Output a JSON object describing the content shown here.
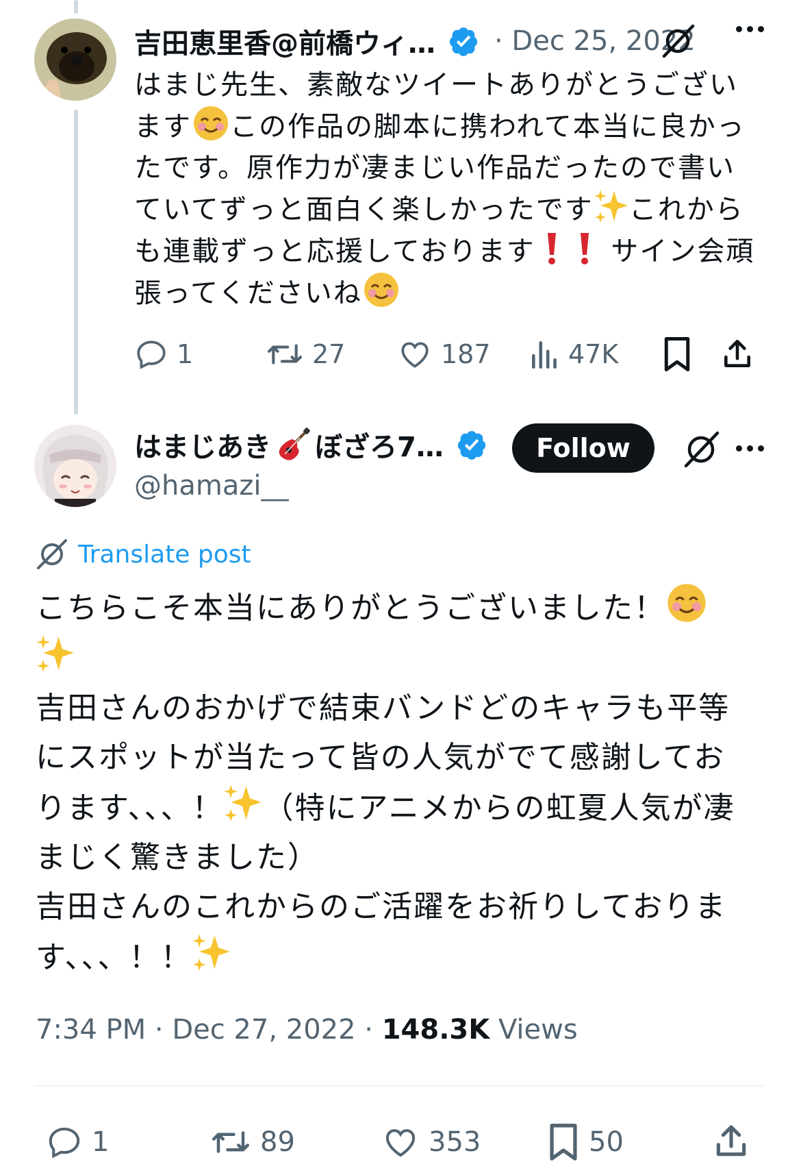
{
  "reply_tweet": {
    "author_name": "吉田恵里香@前橋ウィ…",
    "date": "· Dec 25, 2022",
    "text": "はまじ先生、素敵なツイートありがとうございます😊この作品の脚本に携われて本当に良かったです。原作力が凄まじい作品だったので書いていてずっと面白く楽しかったです✨これからも連載ずっと応援しております❗️❗️サイン会頑張ってくださいね😊",
    "text_parts": {
      "p1": "はまじ先生、素敵なツイートありがとうござい\nます",
      "p2": "この作品の脚本に携われて本当に良かっ\nたです。原作力が凄まじい作品だったので書い\nていてずっと面白く楽しかったです",
      "p3": "これから\nも連載ずっと応援しております",
      "p4": " サイン会頑\n張ってくださいね"
    },
    "actions": {
      "replies": "1",
      "reposts": "27",
      "likes": "187",
      "views": "47K"
    }
  },
  "main_tweet": {
    "author_name": "はまじあき",
    "author_name_suffix": "ぼざろ7…",
    "handle": "@hamazi__",
    "follow_label": "Follow",
    "translate_label": "Translate post",
    "text_parts": {
      "p1": "こちらこそ本当にありがとうございました！",
      "p2": "吉田さんのおかげで結束バンドどのキャラも平等\nにスポットが当たって皆の人気がでて感謝してお\nります、、、！",
      "p3": "（特にアニメからの虹夏人気が凄\nまじく驚きました）\n吉田さんのこれからのご活躍をお祈りしておりま\nす、、、！！"
    },
    "timestamp": "7:34 PM · Dec 27, 2022 · ",
    "views_count": "148.3K",
    "views_label": " Views",
    "actions": {
      "replies": "1",
      "reposts": "89",
      "likes": "353",
      "bookmarks": "50"
    }
  },
  "colors": {
    "text_primary": "#0f1419",
    "text_secondary": "#536471",
    "accent_blue": "#1d9bf0",
    "thread_line": "#cfd9de",
    "verified_blue": "#1d9bf0"
  },
  "icons": [
    "verified-badge-icon",
    "more-icon",
    "grok-icon",
    "reply-icon",
    "repost-icon",
    "like-icon",
    "views-icon",
    "bookmark-icon",
    "share-icon",
    "translate-icon",
    "smile-emoji",
    "sparkles-emoji",
    "exclamation-emoji",
    "guitar-emoji"
  ]
}
